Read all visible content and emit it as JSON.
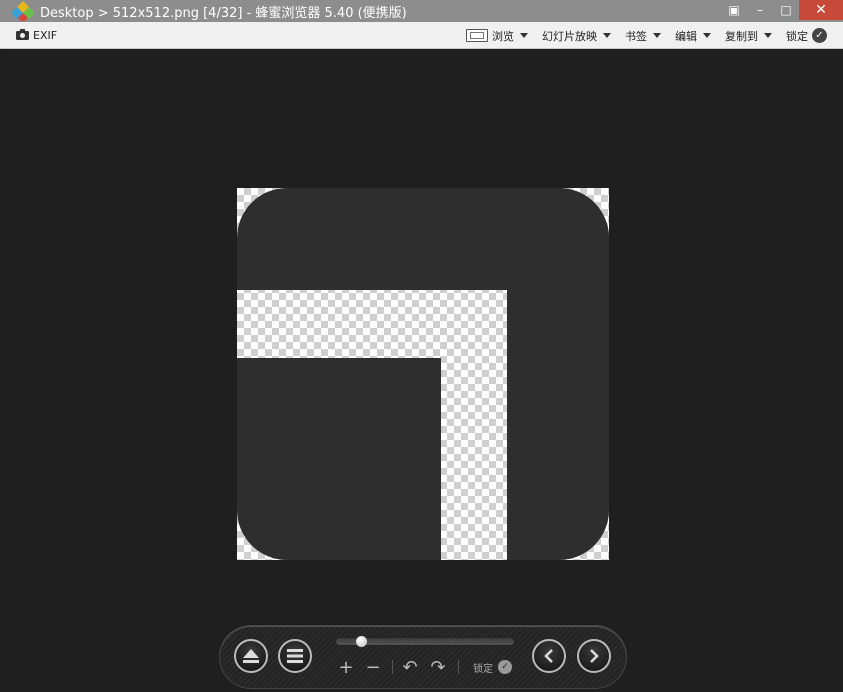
{
  "window": {
    "title": "Desktop > 512x512.png [4/32] - 蜂蜜浏览器 5.40 (便携版)",
    "app_icon": "honeyview-logo-icon",
    "controls": {
      "pin": "▣",
      "minimize": "–",
      "maximize": "□",
      "close": "✕"
    }
  },
  "toolbar": {
    "exif_label": "EXIF",
    "browse_label": "浏览",
    "slideshow_label": "幻灯片放映",
    "bookmark_label": "书签",
    "edit_label": "编辑",
    "copyto_label": "复制到",
    "lock_label": "锁定"
  },
  "image": {
    "file": "512x512.png",
    "index": "4/32",
    "shape_color": "#2e2e2e",
    "checker_color": "#cfcfcf"
  },
  "controls": {
    "zoom_slider_value": 0.07,
    "zoom_in_glyph": "+",
    "zoom_out_glyph": "−",
    "rotate_left_glyph": "↶",
    "rotate_right_glyph": "↷",
    "lock_label": "锁定"
  },
  "colors": {
    "titlebar": "#8d8d8d",
    "close_button": "#c7493a",
    "viewer_bg": "#1e1e1e"
  }
}
